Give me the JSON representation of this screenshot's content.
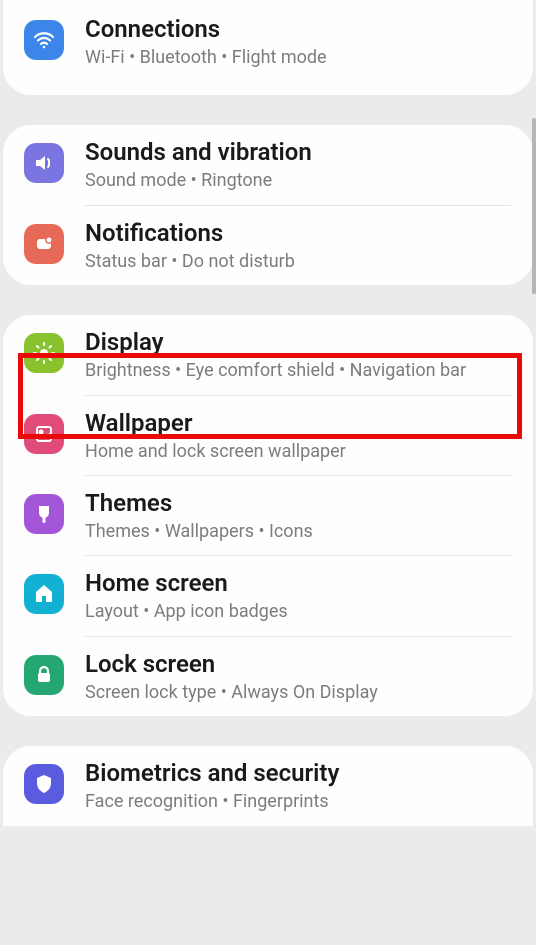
{
  "groups": [
    {
      "items": [
        {
          "key": "connections",
          "title": "Connections",
          "subtitle": "Wi-Fi  •  Bluetooth  •  Flight mode",
          "icon": "wifi-icon",
          "color": "#3b86e8"
        }
      ]
    },
    {
      "items": [
        {
          "key": "sounds",
          "title": "Sounds and vibration",
          "subtitle": "Sound mode  •  Ringtone",
          "icon": "speaker-icon",
          "color": "#7a75e0"
        },
        {
          "key": "notifications",
          "title": "Notifications",
          "subtitle": "Status bar  •  Do not disturb",
          "icon": "notification-icon",
          "color": "#e76958"
        }
      ]
    },
    {
      "items": [
        {
          "key": "display",
          "title": "Display",
          "subtitle": "Brightness  •  Eye comfort shield  •  Navigation bar",
          "icon": "brightness-icon",
          "color": "#89c22d",
          "highlighted": true
        },
        {
          "key": "wallpaper",
          "title": "Wallpaper",
          "subtitle": "Home and lock screen wallpaper",
          "icon": "picture-icon",
          "color": "#e04b79"
        },
        {
          "key": "themes",
          "title": "Themes",
          "subtitle": "Themes  •  Wallpapers  •  Icons",
          "icon": "brush-icon",
          "color": "#a356d8"
        },
        {
          "key": "homescreen",
          "title": "Home screen",
          "subtitle": "Layout  •  App icon badges",
          "icon": "home-icon",
          "color": "#12b1d4"
        },
        {
          "key": "lockscreen",
          "title": "Lock screen",
          "subtitle": "Screen lock type  •  Always On Display",
          "icon": "lock-icon",
          "color": "#25a772"
        }
      ]
    },
    {
      "items": [
        {
          "key": "biometrics",
          "title": "Biometrics and security",
          "subtitle": "Face recognition  •  Fingerprints",
          "icon": "shield-icon",
          "color": "#5a5ce0"
        }
      ]
    }
  ]
}
